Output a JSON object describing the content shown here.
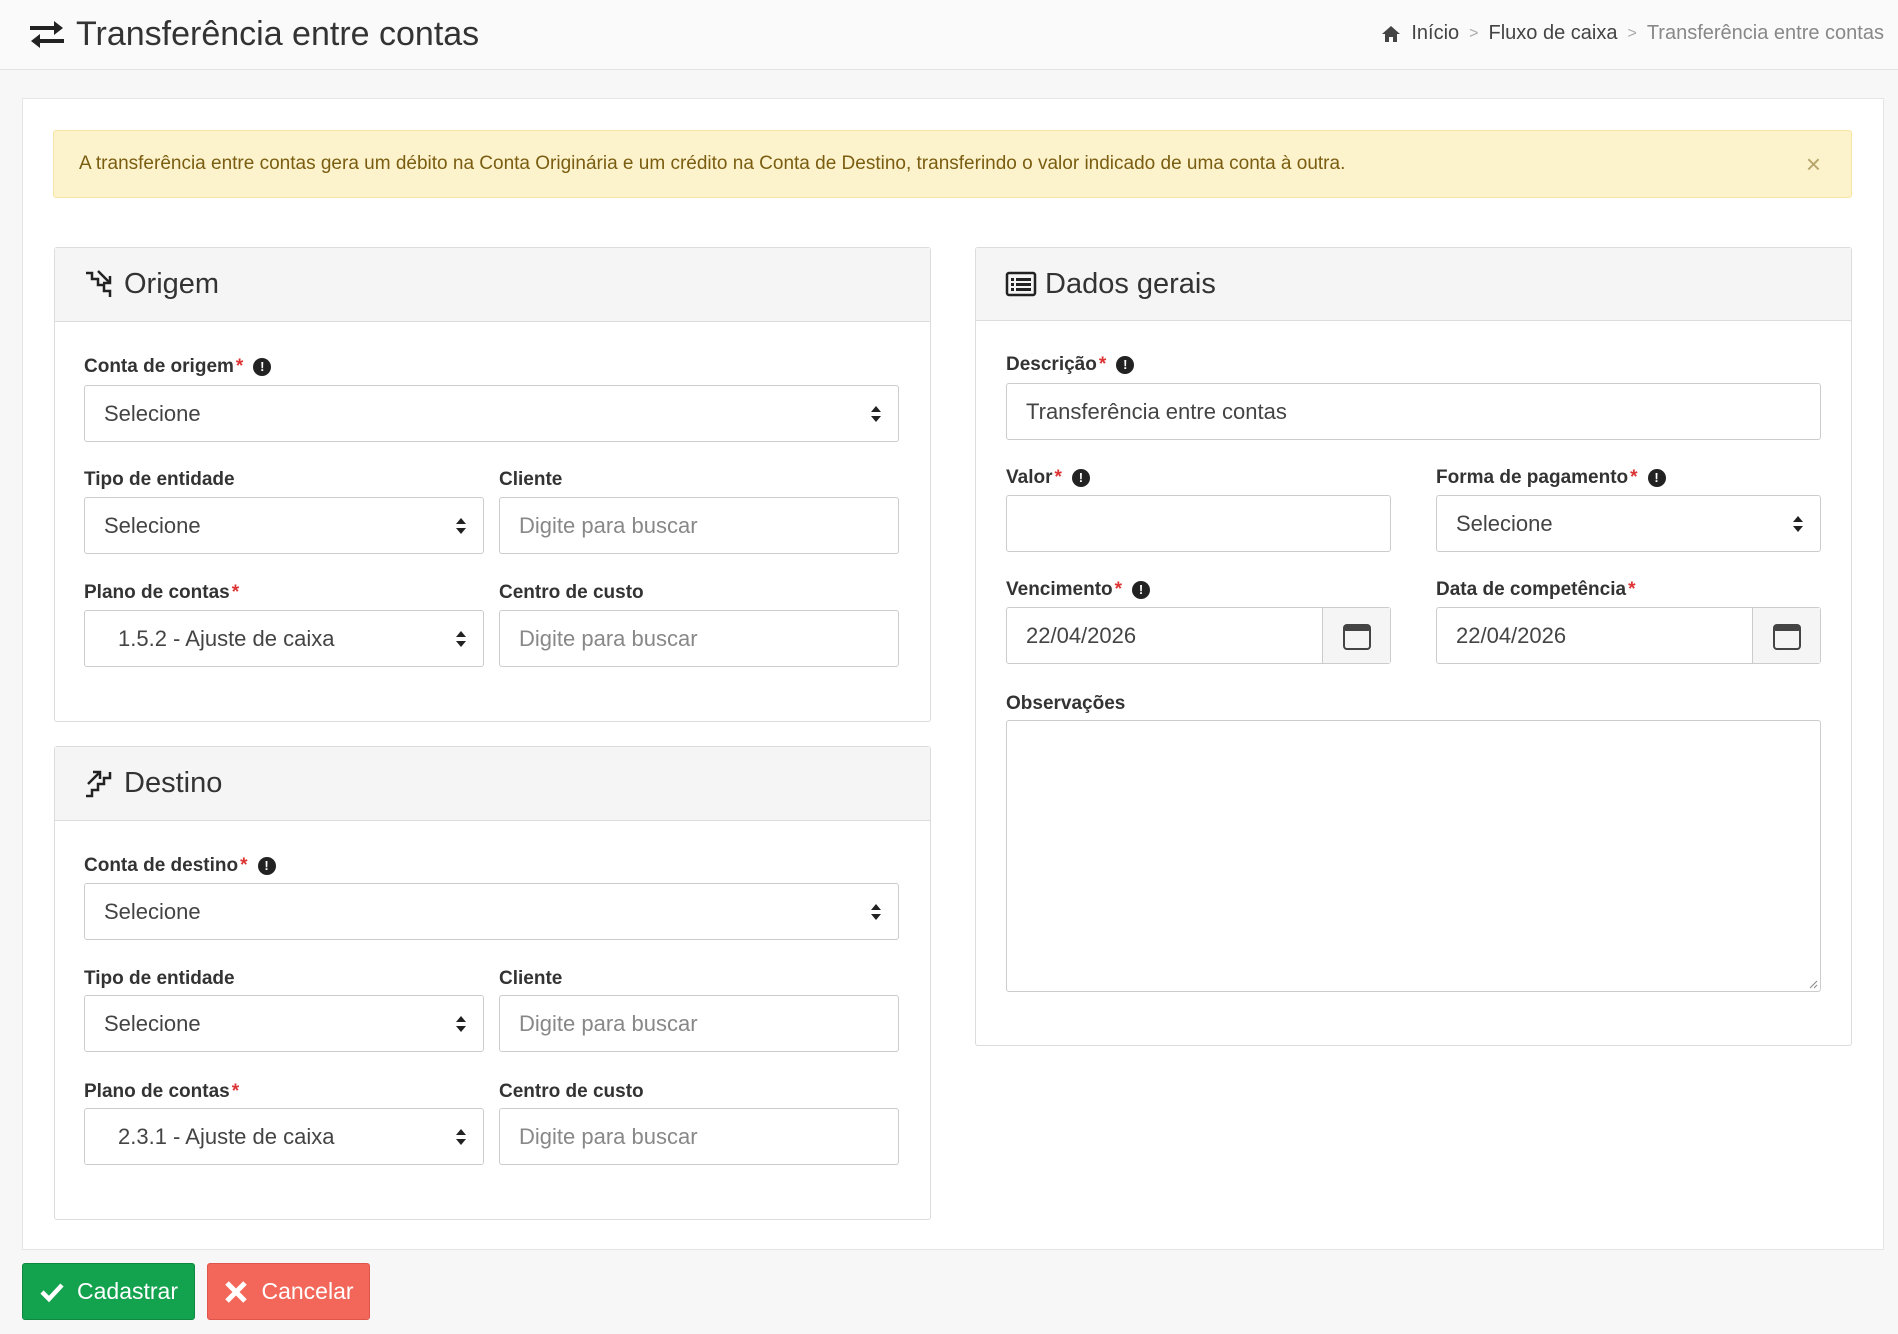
{
  "header": {
    "title": "Transferência entre contas",
    "breadcrumb": {
      "home": "Início",
      "cashflow": "Fluxo de caixa",
      "current": "Transferência entre contas"
    }
  },
  "alert": {
    "text": "A transferência entre contas gera um débito na Conta Originária e um crédito na Conta de Destino, transferindo o valor indicado de uma conta à outra.",
    "close": "×"
  },
  "origem": {
    "title": "Origem",
    "conta_label": "Conta de origem",
    "conta_value": "Selecione",
    "tipo_label": "Tipo de entidade",
    "tipo_value": "Selecione",
    "cliente_label": "Cliente",
    "cliente_placeholder": "Digite para buscar",
    "plano_label": "Plano de contas",
    "plano_value": "1.5.2 - Ajuste de caixa",
    "centro_label": "Centro de custo",
    "centro_placeholder": "Digite para buscar"
  },
  "destino": {
    "title": "Destino",
    "conta_label": "Conta de destino",
    "conta_value": "Selecione",
    "tipo_label": "Tipo de entidade",
    "tipo_value": "Selecione",
    "cliente_label": "Cliente",
    "cliente_placeholder": "Digite para buscar",
    "plano_label": "Plano de contas",
    "plano_value": "2.3.1 - Ajuste de caixa",
    "centro_label": "Centro de custo",
    "centro_placeholder": "Digite para buscar"
  },
  "dados": {
    "title": "Dados gerais",
    "descricao_label": "Descrição",
    "descricao_value": "Transferência entre contas",
    "valor_label": "Valor",
    "valor_value": "",
    "forma_label": "Forma de pagamento",
    "forma_value": "Selecione",
    "vencimento_label": "Vencimento",
    "vencimento_value": "22/04/2026",
    "competencia_label": "Data de competência",
    "competencia_value": "22/04/2026",
    "obs_label": "Observações"
  },
  "common": {
    "required_mark": "*",
    "info_mark": "!"
  },
  "actions": {
    "save": "Cadastrar",
    "cancel": "Cancelar"
  },
  "colors": {
    "success": "#13a24e",
    "danger": "#f2675a",
    "alert_bg": "#fcf3cd",
    "required": "#dd3333"
  },
  "icons": [
    "transfer-icon",
    "home-icon",
    "stairs-down-icon",
    "stairs-up-icon",
    "list-alt-icon",
    "info-icon",
    "select-arrows-icon",
    "calendar-icon",
    "check-icon",
    "times-icon"
  ]
}
